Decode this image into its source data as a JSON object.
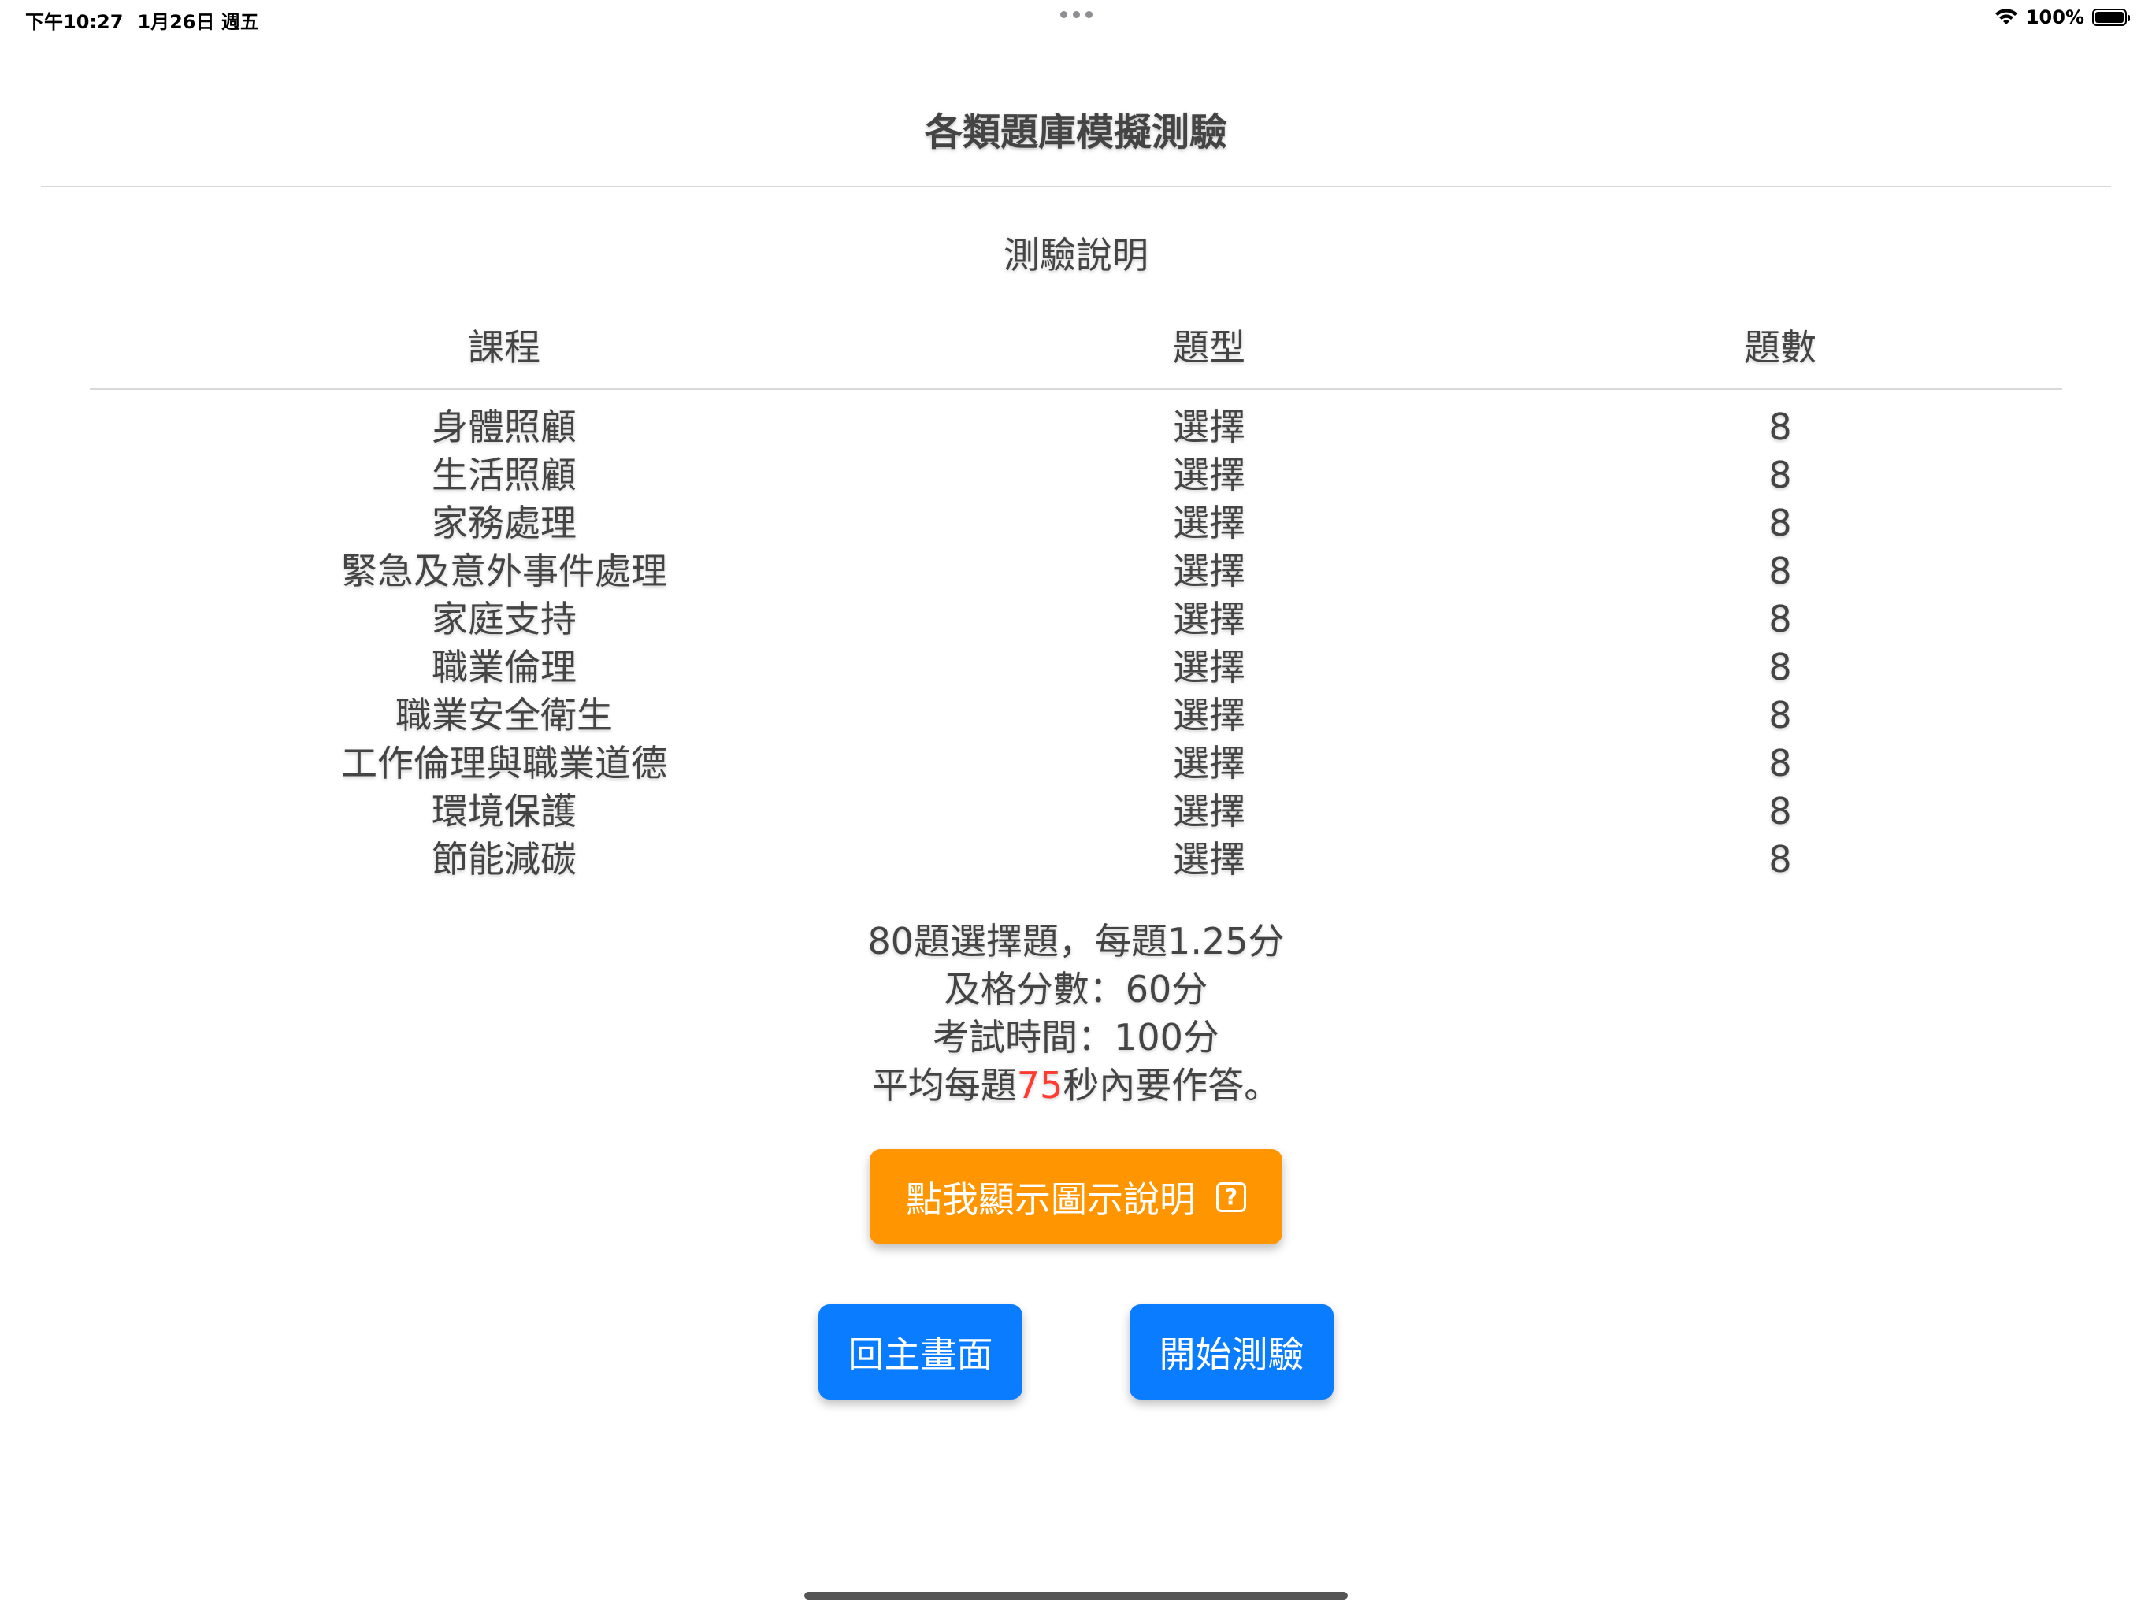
{
  "status_bar": {
    "time": "下午10:27",
    "date": "1月26日 週五",
    "battery": "100%"
  },
  "header": {
    "title": "各類題庫模擬測驗"
  },
  "section": {
    "title": "測驗說明"
  },
  "table": {
    "columns": [
      "課程",
      "題型",
      "題數"
    ],
    "rows": [
      {
        "course": "身體照顧",
        "type": "選擇",
        "count": "8"
      },
      {
        "course": "生活照顧",
        "type": "選擇",
        "count": "8"
      },
      {
        "course": "家務處理",
        "type": "選擇",
        "count": "8"
      },
      {
        "course": "緊急及意外事件處理",
        "type": "選擇",
        "count": "8"
      },
      {
        "course": "家庭支持",
        "type": "選擇",
        "count": "8"
      },
      {
        "course": "職業倫理",
        "type": "選擇",
        "count": "8"
      },
      {
        "course": "職業安全衛生",
        "type": "選擇",
        "count": "8"
      },
      {
        "course": "工作倫理與職業道德",
        "type": "選擇",
        "count": "8"
      },
      {
        "course": "環境保護",
        "type": "選擇",
        "count": "8"
      },
      {
        "course": "節能減碳",
        "type": "選擇",
        "count": "8"
      }
    ]
  },
  "summary": {
    "line1": "80題選擇題，每題1.25分",
    "line2": "及格分數：60分",
    "line3": "考試時間：100分",
    "line4_prefix": "平均每題",
    "line4_highlight": "75",
    "line4_suffix": "秒內要作答。",
    "highlight_color": "#ff3b30"
  },
  "buttons": {
    "guide_label": "點我顯示圖示說明",
    "guide_icon": "help-icon",
    "guide_color": "#ff9500",
    "home_label": "回主畫面",
    "start_label": "開始測驗",
    "primary_color": "#0a7cff"
  }
}
